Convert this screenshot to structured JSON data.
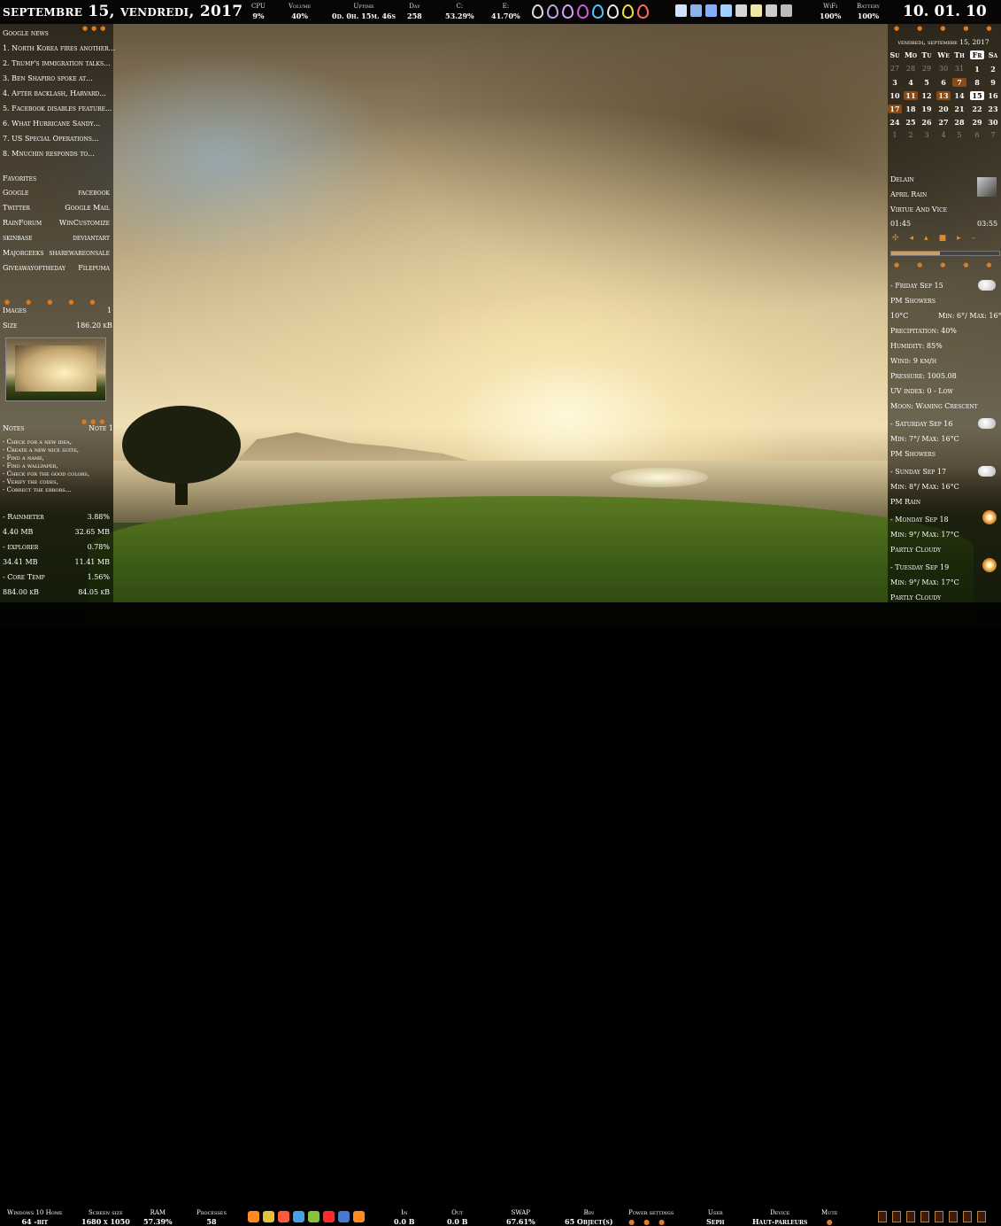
{
  "topbar": {
    "date": "septembre 15, vendredi, 2017",
    "stats": [
      {
        "label": "CPU",
        "value": "9%"
      },
      {
        "label": "Volume",
        "value": "40%"
      },
      {
        "label": "Uptime",
        "value": "0d. 0h. 15m. 46s"
      },
      {
        "label": "Day",
        "value": "258"
      },
      {
        "label": "C:",
        "value": "53.29%"
      },
      {
        "label": "E:",
        "value": "41.70%"
      }
    ],
    "drops": [
      "#dddddd",
      "#b9a7e6",
      "#d9a0ff",
      "#d05adf",
      "#4fc3ff",
      "#eaeaea",
      "#f2dd46",
      "#ff6b5a"
    ],
    "tray_icons": [
      "notepad-icon",
      "tool-icon",
      "gear-icon",
      "monitor-icon",
      "printer-icon",
      "folder-icon",
      "terminal-icon",
      "window-icon"
    ],
    "wifi": {
      "label": "WiFi",
      "value": "100%"
    },
    "battery": {
      "label": "Battery",
      "value": "100%"
    },
    "clock": "10. 01. 10"
  },
  "left": {
    "news_title": "Google news",
    "news": [
      "1. North Korea fires another...",
      "2. Trump's immigration talks...",
      "3. Ben Shapiro spoke at...",
      "4. After backlash, Harvard...",
      "5. Facebook disables feature...",
      "6. What Hurricane Sandy...",
      "7. US Special Operations...",
      "8. Mnuchin responds to..."
    ],
    "favorites_title": "Favorites",
    "favorites": [
      [
        "Google",
        "facebook"
      ],
      [
        "Twitter",
        "Google Mail"
      ],
      [
        "RainForum",
        "WinCustomize"
      ],
      [
        "skinbase",
        "deviantart"
      ],
      [
        "Majorgeeks",
        "sharewareonsale"
      ],
      [
        "Giveawayoftheday",
        "Filepuma"
      ]
    ],
    "images_label": "Images",
    "images_value": "1",
    "size_label": "Size",
    "size_value": "186.20 kB",
    "notes_title": "Notes",
    "notes_page": "Note 1",
    "notes": [
      "- Check for a new idea,",
      "- Create a new nice suite,",
      "- Find a name,",
      "- Find a wallpaper,",
      "- Check for the good colors,",
      "- Verify the codes,",
      "- Correct the errors..."
    ],
    "processes": [
      {
        "name": "- Rainmeter",
        "value": "3.88%",
        "mem1": "4.40 MB",
        "mem2": "32.65 MB"
      },
      {
        "name": "- explorer",
        "value": "0.78%",
        "mem1": "34.41 MB",
        "mem2": "11.41 MB"
      },
      {
        "name": "- Core Temp",
        "value": "1.56%",
        "mem1": "884.00 kB",
        "mem2": "84.05 kB"
      }
    ]
  },
  "calendar": {
    "title": "vendredi, septembre 15, 2017",
    "weekdays": [
      "Su",
      "Mo",
      "Tu",
      "We",
      "Th",
      "Fr",
      "Sa"
    ],
    "rows": [
      [
        "27",
        "28",
        "29",
        "30",
        "31",
        "1",
        "2"
      ],
      [
        "3",
        "4",
        "5",
        "6",
        "7",
        "8",
        "9"
      ],
      [
        "10",
        "11",
        "12",
        "13",
        "14",
        "15",
        "16"
      ],
      [
        "17",
        "18",
        "19",
        "20",
        "21",
        "22",
        "23"
      ],
      [
        "24",
        "25",
        "26",
        "27",
        "28",
        "29",
        "30"
      ],
      [
        "1",
        "2",
        "3",
        "4",
        "5",
        "6",
        "7"
      ]
    ]
  },
  "music": {
    "artist": "Delain",
    "album": "April Rain",
    "track": "Virtue And Vice",
    "elapsed": "01:45",
    "duration": "03:55",
    "progress": 0.45
  },
  "weather": {
    "today_title": "- Friday Sep 15",
    "today_cond": "PM Showers",
    "today_temp": "10°C",
    "today_minmax": "Min: 6°/ Max: 16°C",
    "precip": "Precipitation: 40%",
    "humidity": "Humidity: 85%",
    "wind": "Wind: 9 km/h",
    "pressure": "Pressure: 1005.08",
    "uv": "UV index: 0 - Low",
    "moon": "Moon: Waning Crescent",
    "forecast": [
      {
        "day": "- Saturday Sep 16",
        "minmax": "Min: 7°/ Max: 16°C",
        "cond": "PM Showers"
      },
      {
        "day": "- Sunday Sep 17",
        "minmax": "Min: 8°/ Max: 16°C",
        "cond": "PM Rain"
      },
      {
        "day": "- Monday Sep 18",
        "minmax": "Min: 9°/ Max: 17°C",
        "cond": "Partly Cloudy"
      },
      {
        "day": "- Tuesday Sep 19",
        "minmax": "Min: 9°/ Max: 17°C",
        "cond": "Partly Cloudy"
      }
    ]
  },
  "bottombar": {
    "os_label": "Windows 10 Home",
    "os_value": "64 -bit",
    "screen_label": "Screen size",
    "screen_value": "1680 x 1050",
    "ram_label": "RAM",
    "ram_value": "57.39%",
    "proc_label": "Processes",
    "proc_value": "58",
    "in_label": "In",
    "in_value": "0.0 B",
    "out_label": "Out",
    "out_value": "0.0 B",
    "swap_label": "SWAP",
    "swap_value": "67.61%",
    "bin_label": "Bin",
    "bin_value": "65 Object(s)",
    "power_label": "Power settings",
    "user_label": "User",
    "user_value": "Seph",
    "device_label": "Device",
    "device_value": "Haut-parleurs",
    "mute_label": "Mute"
  }
}
